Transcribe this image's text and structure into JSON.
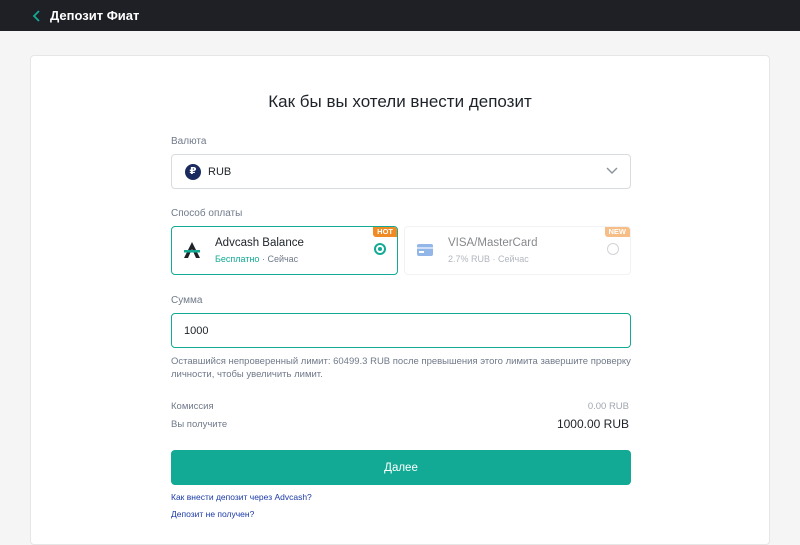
{
  "header": {
    "title": "Депозит Фиат",
    "back_icon": "chevron-left-icon"
  },
  "form": {
    "heading": "Как бы вы хотели внести депозит",
    "currency": {
      "label": "Валюта",
      "value": "RUB",
      "icon_letter": "₽"
    },
    "payment": {
      "label": "Способ оплаты",
      "methods": [
        {
          "name": "Advcash Balance",
          "fee": "Бесплатно",
          "time": " · Сейчас",
          "tag": "HOT",
          "selected": true
        },
        {
          "name": "VISA/MasterCard",
          "fee": "2.7% RUB",
          "time": " · Сейчас",
          "tag": "NEW",
          "selected": false
        }
      ]
    },
    "amount": {
      "label": "Сумма",
      "value": "1000"
    },
    "limit_note": "Оставшийся непроверенный лимит: 60499.3 RUB после превышения этого лимита завершите проверку личности, чтобы увеличить лимит.",
    "fee": {
      "label": "Комиссия",
      "value": "0.00 RUB"
    },
    "receive": {
      "label": "Вы получите",
      "value": "1000.00 RUB"
    },
    "submit_label": "Далее",
    "links": [
      "Как внести депозит через Advcash?",
      "Депозит не получен?"
    ]
  },
  "colors": {
    "accent": "#12aa94",
    "tag": "#f08a24",
    "topbar": "#1e2026"
  }
}
